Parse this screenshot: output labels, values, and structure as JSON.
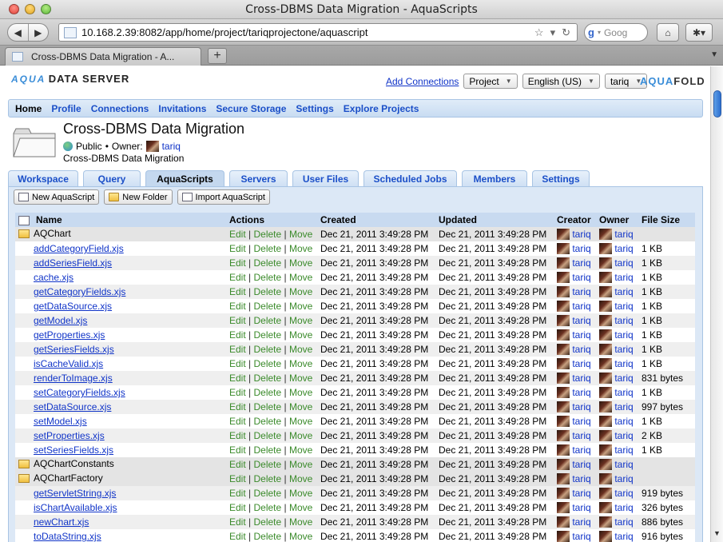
{
  "window": {
    "title": "Cross-DBMS Data Migration - AquaScripts"
  },
  "browser": {
    "url": "10.168.2.39:8082/app/home/project/tariqprojectone/aquascript",
    "search_placeholder": "Goog",
    "tab_title": "Cross-DBMS Data Migration - A..."
  },
  "app": {
    "logo_aqua": "AQUA",
    "logo_text": "DATA SERVER",
    "add_connections": "Add Connections",
    "project_select": "Project",
    "language_select": "English (US)",
    "user_select": "tariq",
    "brand_aqua": "AQUA",
    "brand_fold": "FOLD"
  },
  "nav": {
    "home": "Home",
    "profile": "Profile",
    "connections": "Connections",
    "invitations": "Invitations",
    "secure_storage": "Secure Storage",
    "settings": "Settings",
    "explore": "Explore Projects"
  },
  "project": {
    "title": "Cross-DBMS Data Migration",
    "visibility": "Public",
    "owner_label": "Owner:",
    "owner": "tariq",
    "description": "Cross-DBMS Data Migration"
  },
  "tabs": {
    "workspace": "Workspace",
    "query": "Query",
    "aquascripts": "AquaScripts",
    "servers": "Servers",
    "user_files": "User Files",
    "scheduled_jobs": "Scheduled Jobs",
    "members": "Members",
    "settings": "Settings"
  },
  "actions_bar": {
    "new_script": "New AquaScript",
    "new_folder": "New Folder",
    "import": "Import AquaScript"
  },
  "table": {
    "headers": {
      "name": "Name",
      "actions": "Actions",
      "created": "Created",
      "updated": "Updated",
      "creator": "Creator",
      "owner": "Owner",
      "size": "File Size"
    },
    "edit": "Edit",
    "delete": "Delete",
    "move": "Move",
    "bullet": "•",
    "rows": [
      {
        "name": "AQChart",
        "folder": true,
        "created": "Dec 21, 2011 3:49:28 PM",
        "updated": "Dec 21, 2011 3:49:28 PM",
        "creator": "tariq",
        "owner": "tariq",
        "size": ""
      },
      {
        "name": "addCategoryField.xjs",
        "folder": false,
        "created": "Dec 21, 2011 3:49:28 PM",
        "updated": "Dec 21, 2011 3:49:28 PM",
        "creator": "tariq",
        "owner": "tariq",
        "size": "1 KB"
      },
      {
        "name": "addSeriesField.xjs",
        "folder": false,
        "created": "Dec 21, 2011 3:49:28 PM",
        "updated": "Dec 21, 2011 3:49:28 PM",
        "creator": "tariq",
        "owner": "tariq",
        "size": "1 KB"
      },
      {
        "name": "cache.xjs",
        "folder": false,
        "created": "Dec 21, 2011 3:49:28 PM",
        "updated": "Dec 21, 2011 3:49:28 PM",
        "creator": "tariq",
        "owner": "tariq",
        "size": "1 KB"
      },
      {
        "name": "getCategoryFields.xjs",
        "folder": false,
        "created": "Dec 21, 2011 3:49:28 PM",
        "updated": "Dec 21, 2011 3:49:28 PM",
        "creator": "tariq",
        "owner": "tariq",
        "size": "1 KB"
      },
      {
        "name": "getDataSource.xjs",
        "folder": false,
        "created": "Dec 21, 2011 3:49:28 PM",
        "updated": "Dec 21, 2011 3:49:28 PM",
        "creator": "tariq",
        "owner": "tariq",
        "size": "1 KB"
      },
      {
        "name": "getModel.xjs",
        "folder": false,
        "created": "Dec 21, 2011 3:49:28 PM",
        "updated": "Dec 21, 2011 3:49:28 PM",
        "creator": "tariq",
        "owner": "tariq",
        "size": "1 KB"
      },
      {
        "name": "getProperties.xjs",
        "folder": false,
        "created": "Dec 21, 2011 3:49:28 PM",
        "updated": "Dec 21, 2011 3:49:28 PM",
        "creator": "tariq",
        "owner": "tariq",
        "size": "1 KB"
      },
      {
        "name": "getSeriesFields.xjs",
        "folder": false,
        "created": "Dec 21, 2011 3:49:28 PM",
        "updated": "Dec 21, 2011 3:49:28 PM",
        "creator": "tariq",
        "owner": "tariq",
        "size": "1 KB"
      },
      {
        "name": "isCacheValid.xjs",
        "folder": false,
        "created": "Dec 21, 2011 3:49:28 PM",
        "updated": "Dec 21, 2011 3:49:28 PM",
        "creator": "tariq",
        "owner": "tariq",
        "size": "1 KB"
      },
      {
        "name": "renderToImage.xjs",
        "folder": false,
        "created": "Dec 21, 2011 3:49:28 PM",
        "updated": "Dec 21, 2011 3:49:28 PM",
        "creator": "tariq",
        "owner": "tariq",
        "size": "831 bytes"
      },
      {
        "name": "setCategoryFields.xjs",
        "folder": false,
        "created": "Dec 21, 2011 3:49:28 PM",
        "updated": "Dec 21, 2011 3:49:28 PM",
        "creator": "tariq",
        "owner": "tariq",
        "size": "1 KB"
      },
      {
        "name": "setDataSource.xjs",
        "folder": false,
        "created": "Dec 21, 2011 3:49:28 PM",
        "updated": "Dec 21, 2011 3:49:28 PM",
        "creator": "tariq",
        "owner": "tariq",
        "size": "997 bytes"
      },
      {
        "name": "setModel.xjs",
        "folder": false,
        "created": "Dec 21, 2011 3:49:28 PM",
        "updated": "Dec 21, 2011 3:49:28 PM",
        "creator": "tariq",
        "owner": "tariq",
        "size": "1 KB"
      },
      {
        "name": "setProperties.xjs",
        "folder": false,
        "created": "Dec 21, 2011 3:49:28 PM",
        "updated": "Dec 21, 2011 3:49:28 PM",
        "creator": "tariq",
        "owner": "tariq",
        "size": "2 KB"
      },
      {
        "name": "setSeriesFields.xjs",
        "folder": false,
        "created": "Dec 21, 2011 3:49:28 PM",
        "updated": "Dec 21, 2011 3:49:28 PM",
        "creator": "tariq",
        "owner": "tariq",
        "size": "1 KB"
      },
      {
        "name": "AQChartConstants",
        "folder": true,
        "created": "Dec 21, 2011 3:49:28 PM",
        "updated": "Dec 21, 2011 3:49:28 PM",
        "creator": "tariq",
        "owner": "tariq",
        "size": ""
      },
      {
        "name": "AQChartFactory",
        "folder": true,
        "created": "Dec 21, 2011 3:49:28 PM",
        "updated": "Dec 21, 2011 3:49:28 PM",
        "creator": "tariq",
        "owner": "tariq",
        "size": ""
      },
      {
        "name": "getServletString.xjs",
        "folder": false,
        "created": "Dec 21, 2011 3:49:28 PM",
        "updated": "Dec 21, 2011 3:49:28 PM",
        "creator": "tariq",
        "owner": "tariq",
        "size": "919 bytes"
      },
      {
        "name": "isChartAvailable.xjs",
        "folder": false,
        "created": "Dec 21, 2011 3:49:28 PM",
        "updated": "Dec 21, 2011 3:49:28 PM",
        "creator": "tariq",
        "owner": "tariq",
        "size": "326 bytes"
      },
      {
        "name": "newChart.xjs",
        "folder": false,
        "created": "Dec 21, 2011 3:49:28 PM",
        "updated": "Dec 21, 2011 3:49:28 PM",
        "creator": "tariq",
        "owner": "tariq",
        "size": "886 bytes"
      },
      {
        "name": "toDataString.xjs",
        "folder": false,
        "created": "Dec 21, 2011 3:49:28 PM",
        "updated": "Dec 21, 2011 3:49:28 PM",
        "creator": "tariq",
        "owner": "tariq",
        "size": "916 bytes"
      }
    ]
  }
}
